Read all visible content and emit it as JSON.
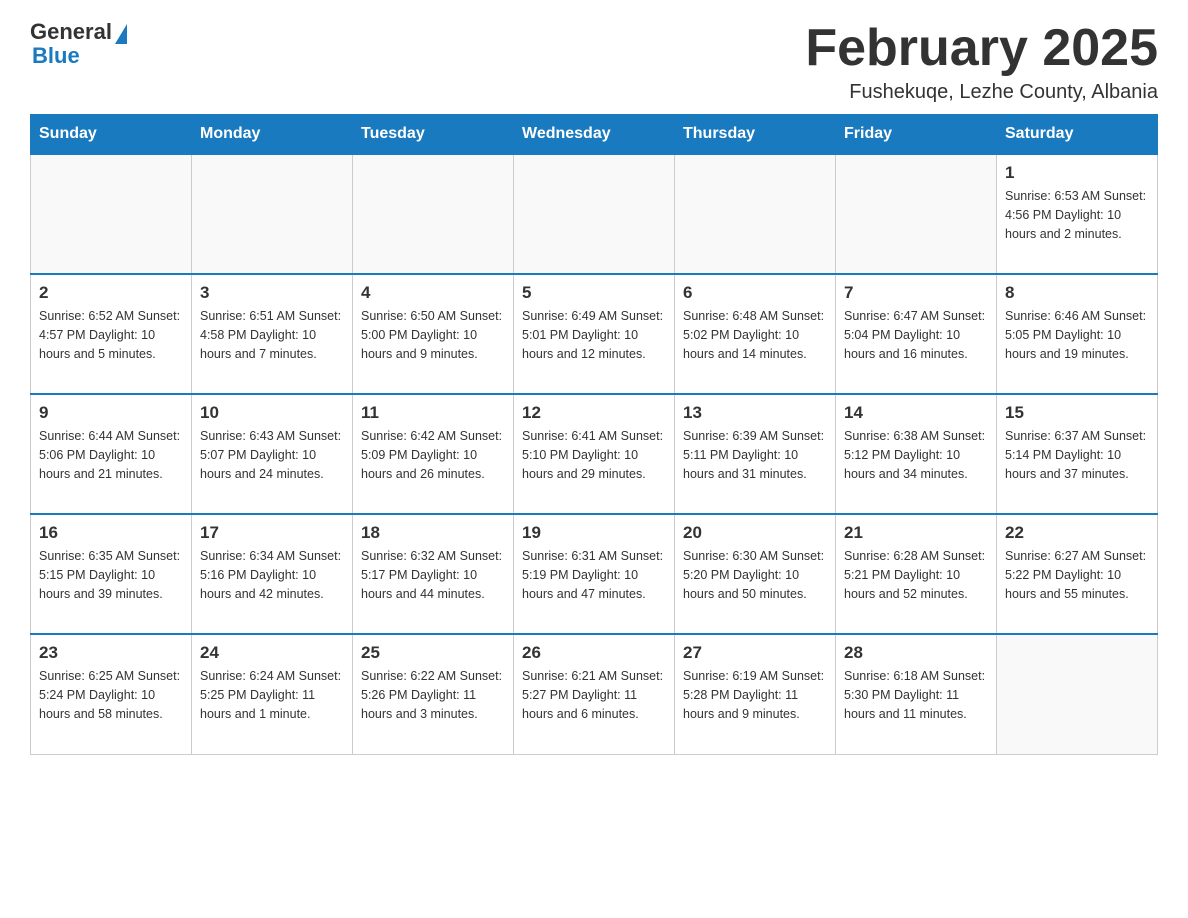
{
  "header": {
    "logo_general": "General",
    "logo_blue": "Blue",
    "month_year": "February 2025",
    "location": "Fushekuqe, Lezhe County, Albania"
  },
  "weekdays": [
    "Sunday",
    "Monday",
    "Tuesday",
    "Wednesday",
    "Thursday",
    "Friday",
    "Saturday"
  ],
  "weeks": [
    [
      {
        "day": "",
        "info": ""
      },
      {
        "day": "",
        "info": ""
      },
      {
        "day": "",
        "info": ""
      },
      {
        "day": "",
        "info": ""
      },
      {
        "day": "",
        "info": ""
      },
      {
        "day": "",
        "info": ""
      },
      {
        "day": "1",
        "info": "Sunrise: 6:53 AM\nSunset: 4:56 PM\nDaylight: 10 hours and 2 minutes."
      }
    ],
    [
      {
        "day": "2",
        "info": "Sunrise: 6:52 AM\nSunset: 4:57 PM\nDaylight: 10 hours and 5 minutes."
      },
      {
        "day": "3",
        "info": "Sunrise: 6:51 AM\nSunset: 4:58 PM\nDaylight: 10 hours and 7 minutes."
      },
      {
        "day": "4",
        "info": "Sunrise: 6:50 AM\nSunset: 5:00 PM\nDaylight: 10 hours and 9 minutes."
      },
      {
        "day": "5",
        "info": "Sunrise: 6:49 AM\nSunset: 5:01 PM\nDaylight: 10 hours and 12 minutes."
      },
      {
        "day": "6",
        "info": "Sunrise: 6:48 AM\nSunset: 5:02 PM\nDaylight: 10 hours and 14 minutes."
      },
      {
        "day": "7",
        "info": "Sunrise: 6:47 AM\nSunset: 5:04 PM\nDaylight: 10 hours and 16 minutes."
      },
      {
        "day": "8",
        "info": "Sunrise: 6:46 AM\nSunset: 5:05 PM\nDaylight: 10 hours and 19 minutes."
      }
    ],
    [
      {
        "day": "9",
        "info": "Sunrise: 6:44 AM\nSunset: 5:06 PM\nDaylight: 10 hours and 21 minutes."
      },
      {
        "day": "10",
        "info": "Sunrise: 6:43 AM\nSunset: 5:07 PM\nDaylight: 10 hours and 24 minutes."
      },
      {
        "day": "11",
        "info": "Sunrise: 6:42 AM\nSunset: 5:09 PM\nDaylight: 10 hours and 26 minutes."
      },
      {
        "day": "12",
        "info": "Sunrise: 6:41 AM\nSunset: 5:10 PM\nDaylight: 10 hours and 29 minutes."
      },
      {
        "day": "13",
        "info": "Sunrise: 6:39 AM\nSunset: 5:11 PM\nDaylight: 10 hours and 31 minutes."
      },
      {
        "day": "14",
        "info": "Sunrise: 6:38 AM\nSunset: 5:12 PM\nDaylight: 10 hours and 34 minutes."
      },
      {
        "day": "15",
        "info": "Sunrise: 6:37 AM\nSunset: 5:14 PM\nDaylight: 10 hours and 37 minutes."
      }
    ],
    [
      {
        "day": "16",
        "info": "Sunrise: 6:35 AM\nSunset: 5:15 PM\nDaylight: 10 hours and 39 minutes."
      },
      {
        "day": "17",
        "info": "Sunrise: 6:34 AM\nSunset: 5:16 PM\nDaylight: 10 hours and 42 minutes."
      },
      {
        "day": "18",
        "info": "Sunrise: 6:32 AM\nSunset: 5:17 PM\nDaylight: 10 hours and 44 minutes."
      },
      {
        "day": "19",
        "info": "Sunrise: 6:31 AM\nSunset: 5:19 PM\nDaylight: 10 hours and 47 minutes."
      },
      {
        "day": "20",
        "info": "Sunrise: 6:30 AM\nSunset: 5:20 PM\nDaylight: 10 hours and 50 minutes."
      },
      {
        "day": "21",
        "info": "Sunrise: 6:28 AM\nSunset: 5:21 PM\nDaylight: 10 hours and 52 minutes."
      },
      {
        "day": "22",
        "info": "Sunrise: 6:27 AM\nSunset: 5:22 PM\nDaylight: 10 hours and 55 minutes."
      }
    ],
    [
      {
        "day": "23",
        "info": "Sunrise: 6:25 AM\nSunset: 5:24 PM\nDaylight: 10 hours and 58 minutes."
      },
      {
        "day": "24",
        "info": "Sunrise: 6:24 AM\nSunset: 5:25 PM\nDaylight: 11 hours and 1 minute."
      },
      {
        "day": "25",
        "info": "Sunrise: 6:22 AM\nSunset: 5:26 PM\nDaylight: 11 hours and 3 minutes."
      },
      {
        "day": "26",
        "info": "Sunrise: 6:21 AM\nSunset: 5:27 PM\nDaylight: 11 hours and 6 minutes."
      },
      {
        "day": "27",
        "info": "Sunrise: 6:19 AM\nSunset: 5:28 PM\nDaylight: 11 hours and 9 minutes."
      },
      {
        "day": "28",
        "info": "Sunrise: 6:18 AM\nSunset: 5:30 PM\nDaylight: 11 hours and 11 minutes."
      },
      {
        "day": "",
        "info": ""
      }
    ]
  ]
}
